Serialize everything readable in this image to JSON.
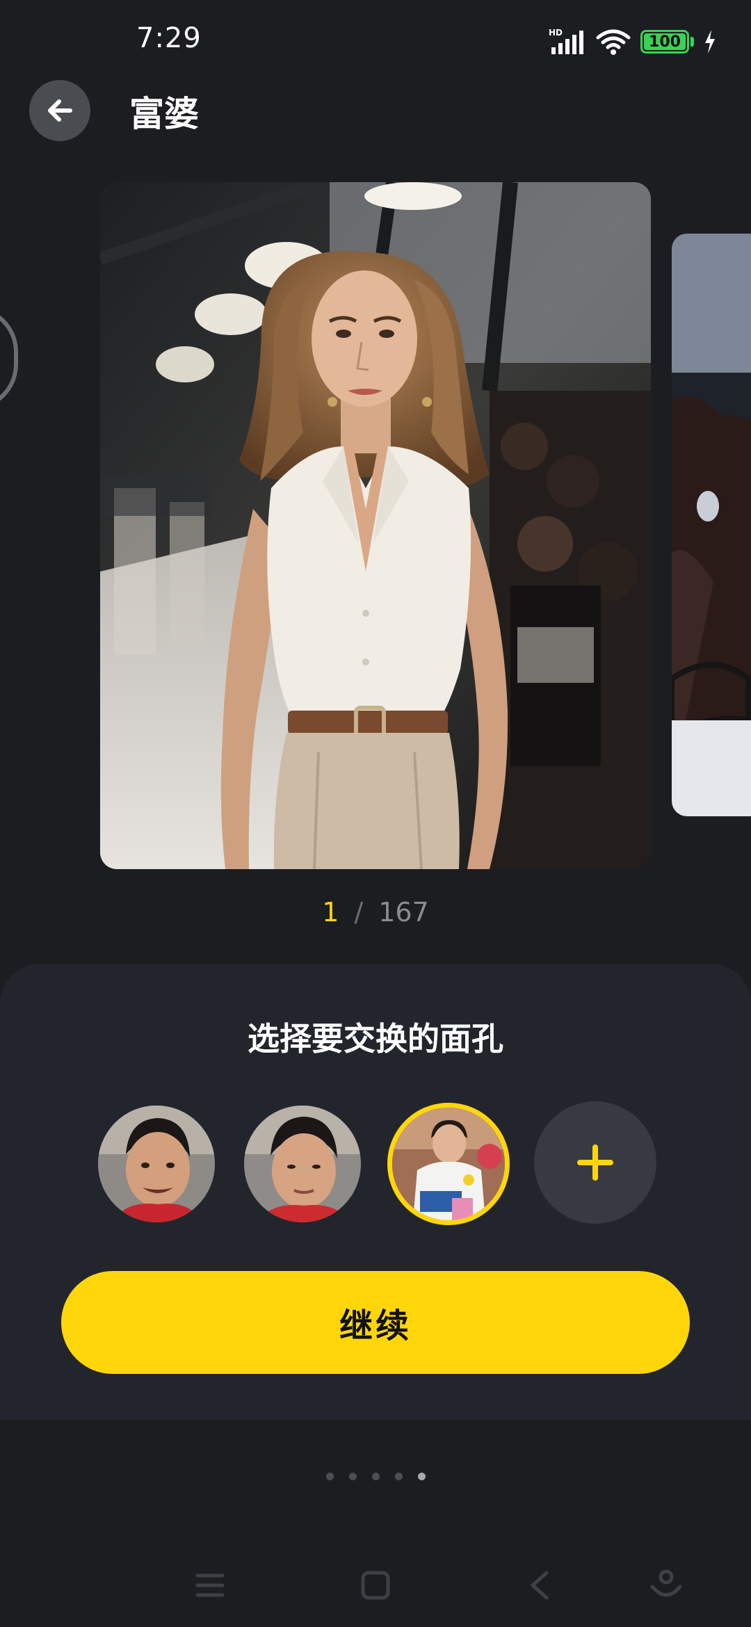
{
  "status_bar": {
    "time": "7:29",
    "network_badge": "HD",
    "battery_level": "100",
    "icons": [
      "signal-icon",
      "wifi-icon",
      "battery-icon",
      "charging-icon"
    ]
  },
  "header": {
    "back_icon": "arrow-left-icon",
    "title": "富婆"
  },
  "carousel": {
    "current": "1",
    "separator": "/",
    "total": "167",
    "slide_count": 5,
    "active_slide": 5
  },
  "face_picker": {
    "title": "选择要交换的面孔",
    "faces": [
      {
        "selected": false
      },
      {
        "selected": false
      },
      {
        "selected": true
      }
    ],
    "add_icon": "plus-icon",
    "continue_label": "继续"
  },
  "nav_bar": {
    "items": [
      "menu-icon",
      "home-icon",
      "back-icon",
      "assistant-icon"
    ]
  },
  "colors": {
    "background": "#1c1d21",
    "sheet": "#23252d",
    "accent": "#ffd60a",
    "muted_text": "#8b8c90"
  }
}
